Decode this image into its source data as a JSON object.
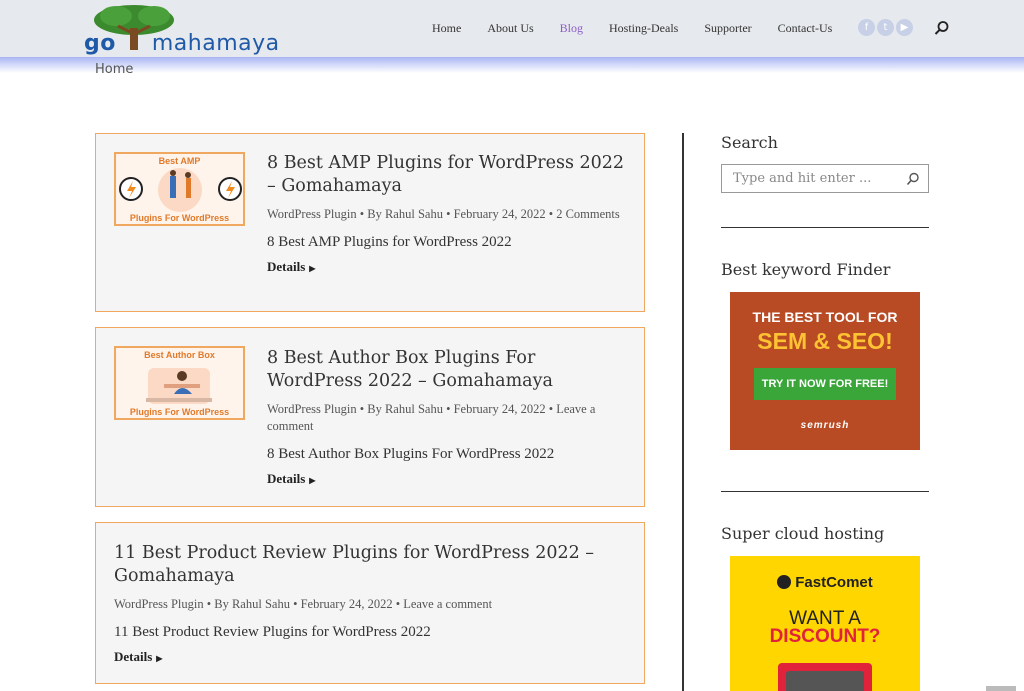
{
  "site": {
    "logo_go": "go",
    "logo_rest": "mahamaya"
  },
  "nav": {
    "items": [
      {
        "label": "Home",
        "active": false
      },
      {
        "label": "About Us",
        "active": false
      },
      {
        "label": "Blog",
        "active": true
      },
      {
        "label": "Hosting-Deals",
        "active": false
      },
      {
        "label": "Supporter",
        "active": false
      },
      {
        "label": "Contact-Us",
        "active": false
      }
    ],
    "social": [
      "f",
      "t",
      "▶"
    ],
    "active_color": "#8c5cc7"
  },
  "breadcrumb": "Home",
  "posts": [
    {
      "thumb_top": "Best AMP",
      "thumb_bottom": "Plugins For WordPress",
      "title": "8 Best AMP Plugins for WordPress 2022 – Gomahamaya",
      "meta": "WordPress Plugin • By Rahul Sahu • February 24, 2022 • 2 Comments",
      "excerpt": "8 Best AMP Plugins for WordPress 2022",
      "details": "Details"
    },
    {
      "thumb_top": "Best Author Box",
      "thumb_bottom": "Plugins For WordPress",
      "title": "8 Best Author Box Plugins For WordPress 2022 – Gomahamaya",
      "meta": "WordPress Plugin • By Rahul Sahu • February 24, 2022 • Leave a comment",
      "excerpt": "8 Best Author Box Plugins For WordPress 2022",
      "details": "Details"
    },
    {
      "title": "11 Best Product Review Plugins for WordPress 2022 – Gomahamaya",
      "meta": "WordPress Plugin • By Rahul Sahu • February 24, 2022 • Leave a comment",
      "excerpt": "11 Best Product Review Plugins for WordPress 2022",
      "details": "Details"
    }
  ],
  "sidebar": {
    "search_title": "Search",
    "search_placeholder": "Type and hit enter ...",
    "keyword_title": "Best keyword Finder",
    "semrush": {
      "line1": "THE BEST TOOL FOR",
      "line2": "SEM & SEO!",
      "cta": "TRY IT NOW FOR FREE!",
      "brand": "semrush"
    },
    "hosting_title": "Super cloud hosting",
    "fastcomet": {
      "brand": "FastComet",
      "line1": "WANT A",
      "line2": "DISCOUNT?"
    }
  },
  "colors": {
    "card_border": "#f0a860",
    "header_bg": "#e6e9ed"
  }
}
